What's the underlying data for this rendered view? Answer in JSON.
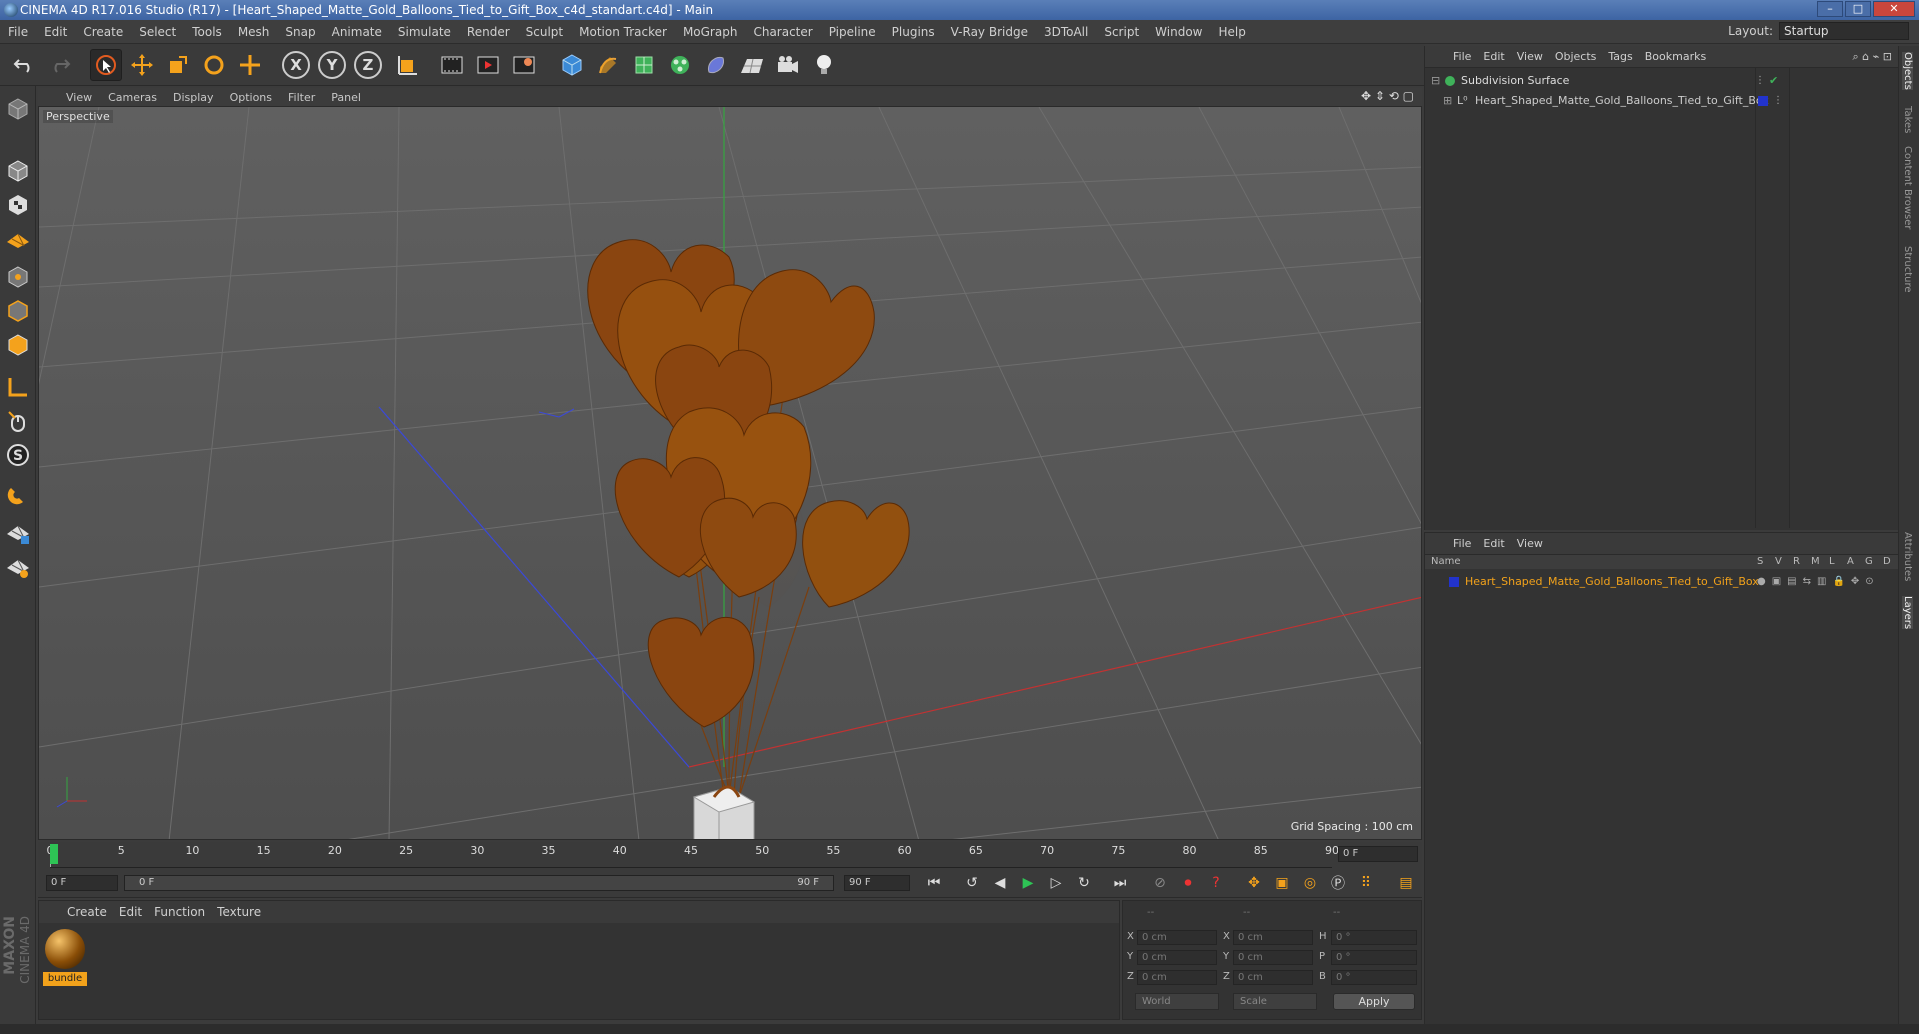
{
  "window": {
    "title": "CINEMA 4D R17.016 Studio (R17) - [Heart_Shaped_Matte_Gold_Balloons_Tied_to_Gift_Box_c4d_standart.c4d] - Main",
    "minimize": "–",
    "maximize": "□",
    "close": "✕"
  },
  "menubar": {
    "items": [
      "File",
      "Edit",
      "Create",
      "Select",
      "Tools",
      "Mesh",
      "Snap",
      "Animate",
      "Simulate",
      "Render",
      "Sculpt",
      "Motion Tracker",
      "MoGraph",
      "Character",
      "Pipeline",
      "Plugins",
      "V-Ray Bridge",
      "3DToAll",
      "Script",
      "Window",
      "Help"
    ],
    "layout_label": "Layout:",
    "layout_value": "Startup"
  },
  "toolbar": {
    "axis_x": "X",
    "axis_y": "Y",
    "axis_z": "Z"
  },
  "viewport": {
    "menu": [
      "View",
      "Cameras",
      "Display",
      "Options",
      "Filter",
      "Panel"
    ],
    "label": "Perspective",
    "grid_spacing": "Grid Spacing : 100 cm"
  },
  "timeline": {
    "ticks": [
      "0",
      "5",
      "10",
      "15",
      "20",
      "25",
      "30",
      "35",
      "40",
      "45",
      "50",
      "55",
      "60",
      "65",
      "70",
      "75",
      "80",
      "85",
      "90"
    ],
    "current_frame": "0 F",
    "start_frame": "0 F",
    "range_start": "0 F",
    "range_end": "90 F",
    "end_frame": "90 F"
  },
  "material_panel": {
    "menu": [
      "Create",
      "Edit",
      "Function",
      "Texture"
    ],
    "material_name": "bundle"
  },
  "coordinates": {
    "headers": [
      "--",
      "--",
      "--"
    ],
    "pos_x": "0 cm",
    "pos_y": "0 cm",
    "pos_z": "0 cm",
    "size_x": "0 cm",
    "size_y": "0 cm",
    "size_z": "0 cm",
    "rot_h": "0 °",
    "rot_p": "0 °",
    "rot_b": "0 °",
    "labels": {
      "x": "X",
      "y": "Y",
      "z": "Z",
      "h": "H",
      "p": "P",
      "b": "B"
    },
    "mode": "World",
    "scale_mode": "Scale",
    "apply": "Apply"
  },
  "object_manager": {
    "menu": [
      "File",
      "Edit",
      "View",
      "Objects",
      "Tags",
      "Bookmarks"
    ],
    "objects": [
      {
        "name": "Subdivision Surface"
      },
      {
        "name": "Heart_Shaped_Matte_Gold_Balloons_Tied_to_Gift_Box"
      }
    ]
  },
  "layer_manager": {
    "menu": [
      "File",
      "Edit",
      "View"
    ],
    "columns": [
      "Name",
      "S",
      "V",
      "R",
      "M",
      "L",
      "A",
      "G",
      "D"
    ],
    "layers": [
      {
        "name": "Heart_Shaped_Matte_Gold_Balloons_Tied_to_Gift_Box"
      }
    ]
  },
  "right_tabs": [
    "Objects",
    "Takes",
    "Content Browser",
    "Structure",
    "Attributes",
    "Layers"
  ],
  "branding": {
    "maxon": "MAXON",
    "product": "CINEMA 4D"
  },
  "colors": {
    "balloon": "#8a4510",
    "accent_orange": "#f2a21b",
    "layer_blue": "#2233cc",
    "playhead_green": "#2ec455"
  }
}
